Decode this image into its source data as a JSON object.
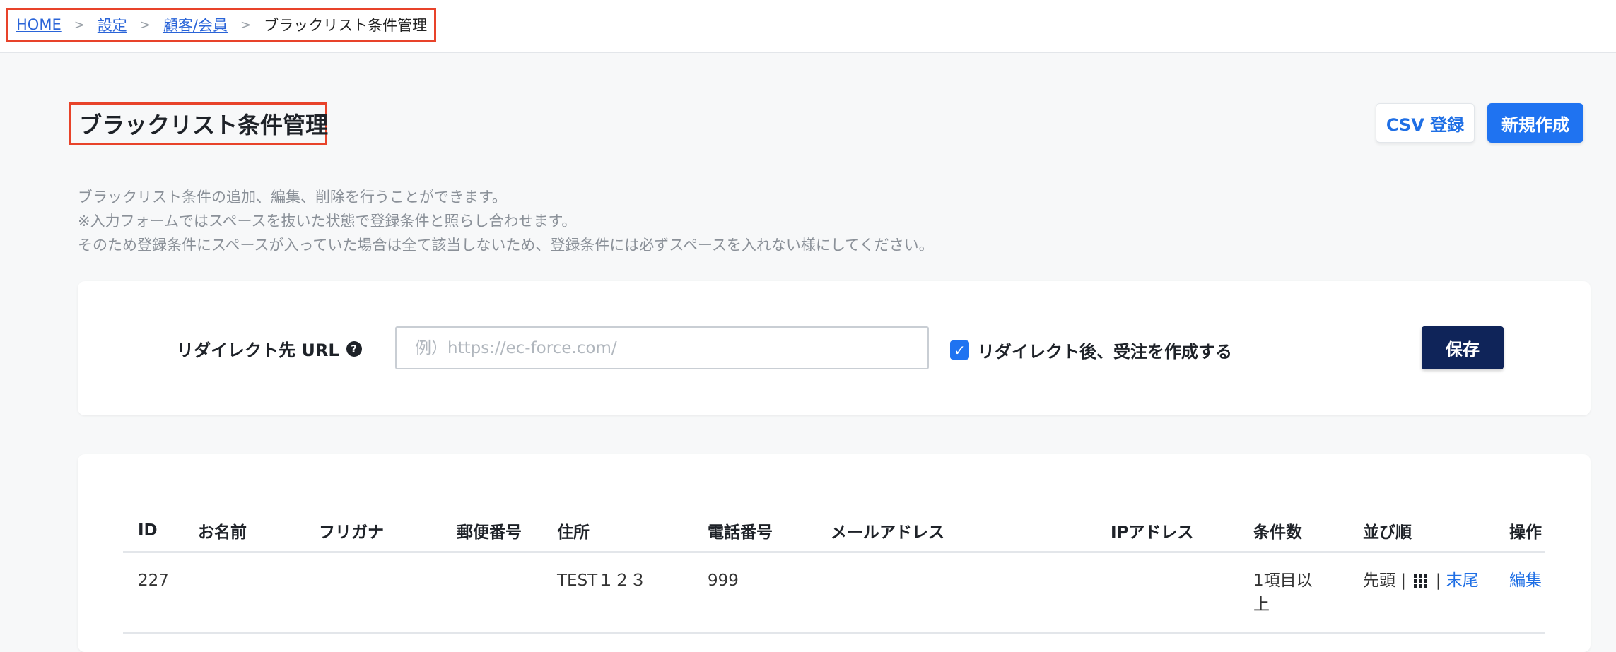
{
  "breadcrumb": {
    "home": "HOME",
    "settings": "設定",
    "customers": "顧客/会員",
    "current": "ブラックリスト条件管理",
    "separator": ">"
  },
  "page": {
    "title": "ブラックリスト条件管理",
    "csv_button": "CSV 登録",
    "new_button": "新規作成",
    "description": [
      "ブラックリスト条件の追加、編集、削除を行うことができます。",
      "※入力フォームではスペースを抜いた状態で登録条件と照らし合わせます。",
      "そのため登録条件にスペースが入っていた場合は全て該当しないため、登録条件には必ずスペースを入れない様にしてください。"
    ]
  },
  "redirect": {
    "label": "リダイレクト先 URL",
    "help_icon": "question-circle-icon",
    "url_value": "",
    "url_placeholder": "例）https://ec-force.com/",
    "checkbox_label": "リダイレクト後、受注を作成する",
    "checkbox_checked": true,
    "save_button": "保存"
  },
  "table": {
    "headers": {
      "id": "ID",
      "name": "お名前",
      "kana": "フリガナ",
      "zip": "郵便番号",
      "address": "住所",
      "phone": "電話番号",
      "email": "メールアドレス",
      "ip": "IPアドレス",
      "conditions": "条件数",
      "order": "並び順",
      "actions": "操作"
    },
    "rows": [
      {
        "id": "227",
        "name": "",
        "kana": "",
        "zip": "",
        "address": "TEST１２３",
        "phone": "999",
        "email": "",
        "ip": "",
        "conditions": "1項目以上",
        "order_first": "先頭",
        "order_sep": "|",
        "order_last": "末尾",
        "edit": "編集"
      }
    ]
  },
  "colors": {
    "accent": "#1f73f1",
    "navy": "#0f2459",
    "highlight": "#e8432a",
    "link": "#2a64d8"
  }
}
